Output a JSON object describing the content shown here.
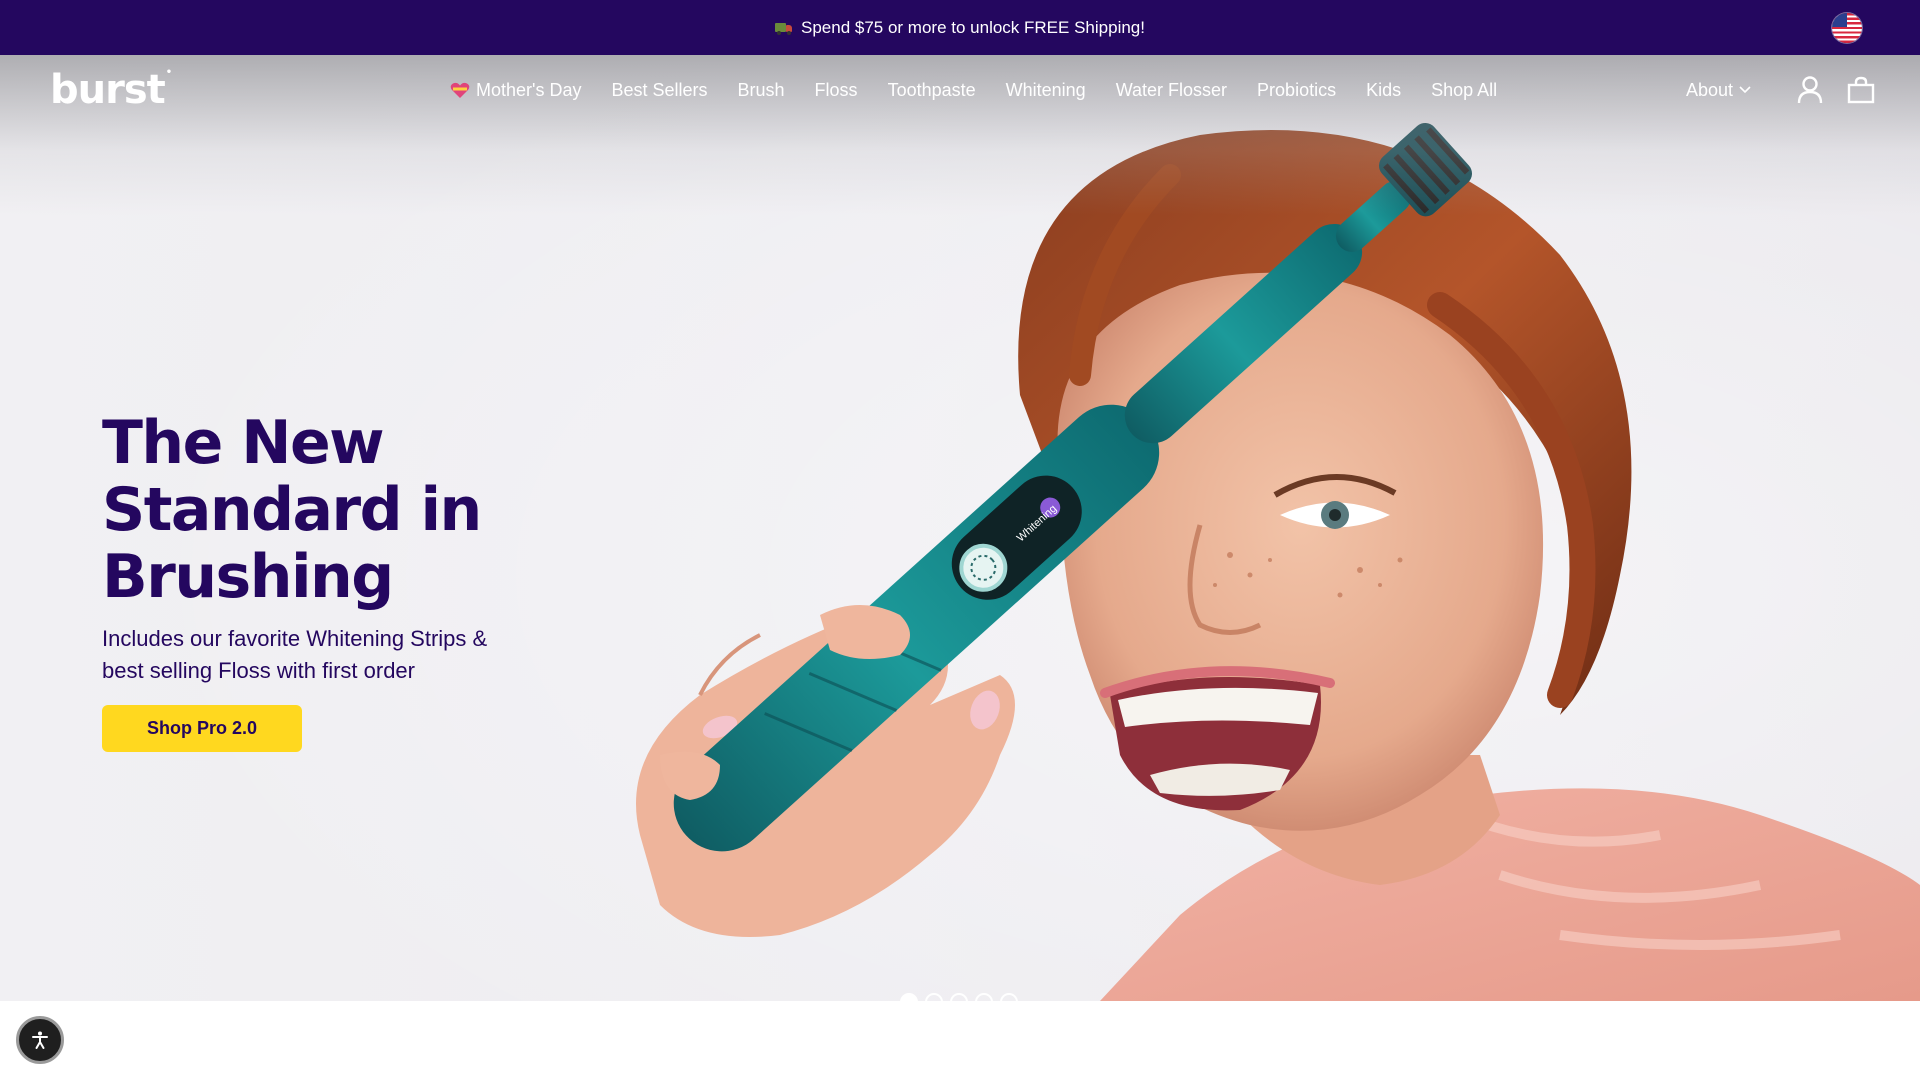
{
  "announcement": {
    "icon": "delivery-truck-icon",
    "text": "Spend $75 or more to unlock FREE Shipping!",
    "flag_icon": "us-flag-icon"
  },
  "brand": {
    "logo": "burst",
    "tm": "•"
  },
  "nav": {
    "items": [
      {
        "label": "Mother's Day",
        "icon": "heart-icon"
      },
      {
        "label": "Best Sellers"
      },
      {
        "label": "Brush"
      },
      {
        "label": "Floss"
      },
      {
        "label": "Toothpaste"
      },
      {
        "label": "Whitening"
      },
      {
        "label": "Water Flosser"
      },
      {
        "label": "Probiotics"
      },
      {
        "label": "Kids"
      },
      {
        "label": "Shop All"
      }
    ],
    "about": "About",
    "account_icon": "user-icon",
    "cart_icon": "shopping-bag-icon"
  },
  "hero": {
    "headline": "The New Standard in Brushing",
    "subline": "Includes our favorite Whitening Strips & best selling Floss with first order",
    "cta": "Shop Pro 2.0",
    "brush_display_text": "Whitening",
    "slides": {
      "count": 5,
      "active": 1
    }
  },
  "accessibility": {
    "icon": "accessibility-icon"
  },
  "colors": {
    "brand_purple": "#24075f",
    "cta_yellow": "#ffd81f",
    "brush_teal": "#1c8c8c"
  }
}
